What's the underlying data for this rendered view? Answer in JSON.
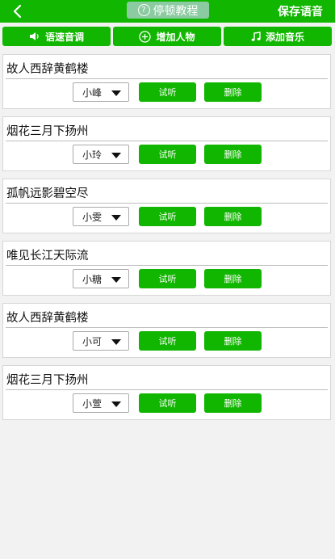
{
  "header": {
    "tutorial_label": "停顿教程",
    "save_label": "保存语音"
  },
  "toolbar": {
    "speed_label": "语速音调",
    "add_person_label": "增加人物",
    "add_music_label": "添加音乐"
  },
  "items": [
    {
      "text": "故人西辞黄鹤楼",
      "voice": "小峰"
    },
    {
      "text": "烟花三月下扬州",
      "voice": "小玲"
    },
    {
      "text": "孤帆远影碧空尽",
      "voice": "小雯"
    },
    {
      "text": "唯见长江天际流",
      "voice": "小糖"
    },
    {
      "text": "故人西辞黄鹤楼",
      "voice": "小可"
    },
    {
      "text": "烟花三月下扬州",
      "voice": "小萱"
    }
  ],
  "actions": {
    "listen_label": "试听",
    "delete_label": "删除"
  },
  "colors": {
    "accent": "#11b600",
    "tutorial_bg": "#8ccaa1"
  },
  "icons": {
    "back": "chevron-left-icon",
    "tutorial": "question-circle-icon",
    "speed": "speaker-icon",
    "add_person": "plus-circle-icon",
    "add_music": "music-note-icon",
    "dropdown": "caret-down-icon"
  }
}
